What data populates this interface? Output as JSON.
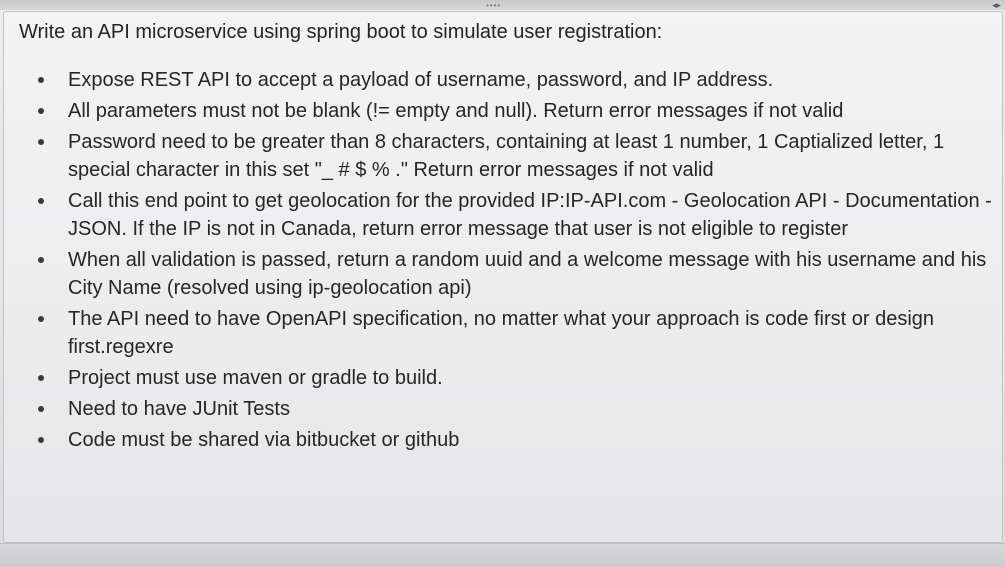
{
  "document": {
    "heading": "Write an API microservice using spring boot to simulate user registration:",
    "bullets": [
      "Expose REST API to accept a payload of username, password, and IP address.",
      "All parameters must not be blank (!= empty and null). Return error messages if not valid",
      "Password need to be greater than 8 characters, containing at least 1 number, 1 Captialized letter, 1 special character in this set \"_ # $ % .\" Return error messages if not valid",
      "Call this end point to get geolocation for the provided IP:IP-API.com - Geolocation API - Documentation - JSON. If the IP is not in Canada, return error message that user is not eligible to register",
      "When all validation is passed, return a random uuid and a welcome message with his username and his City Name (resolved using ip-geolocation api)",
      "The API need to have OpenAPI specification, no matter what your approach is code first or design first.regexre",
      "Project must use maven or gradle to build.",
      "Need to have JUnit Tests",
      "Code must be shared via bitbucket or github"
    ]
  },
  "icons": {
    "grip": "drag-handle-icon",
    "collapse": "collapse-arrows-icon"
  },
  "colors": {
    "text": "#262626",
    "background": "#ececed"
  }
}
